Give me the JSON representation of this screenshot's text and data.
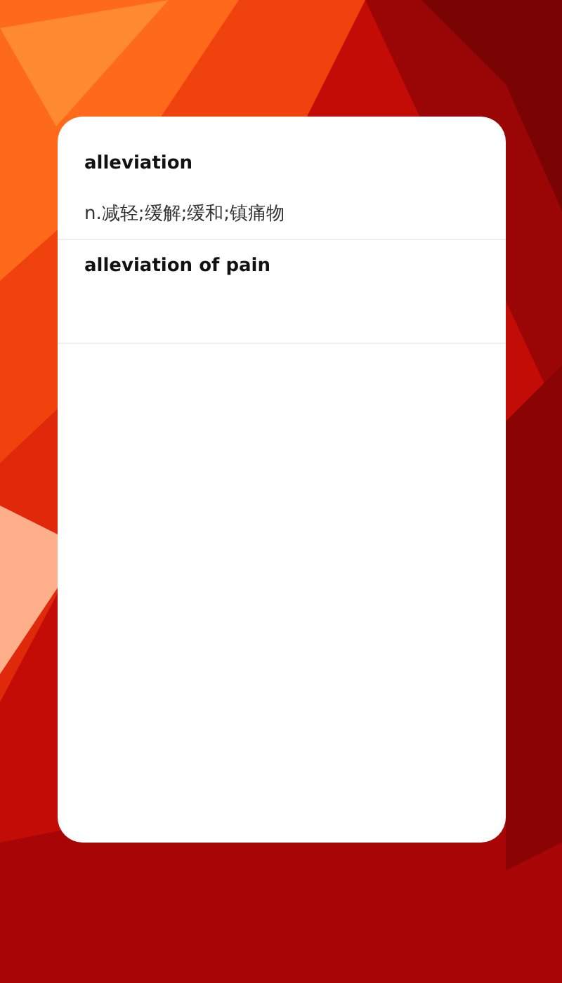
{
  "entries": [
    {
      "word": "alleviation",
      "meaning": "n.减轻;缓解;缓和;镇痛物"
    },
    {
      "word": "alleviation of pain"
    }
  ]
}
